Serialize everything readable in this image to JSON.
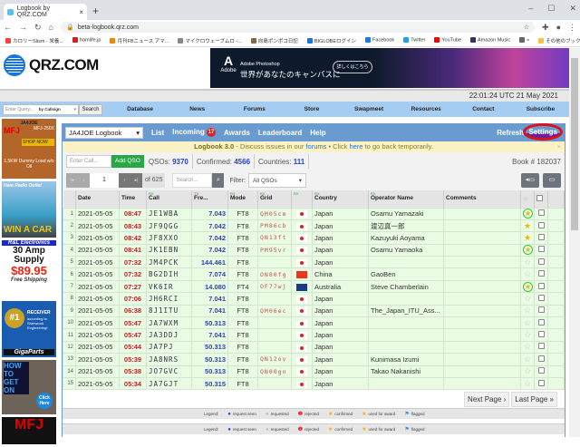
{
  "browser": {
    "tab_title": "Logbook by QRZ.COM",
    "url": "beta-logbook.qrz.com",
    "bookmarks": [
      "カロリーSlism - 栄養...",
      "hamlife.jp",
      "月刊FBニュース アマ...",
      "マイクロウェーブムロ -...",
      "向島ポンポコ日記",
      "BIGLOBEログイン",
      "Facebook",
      "Twitter",
      "YouTube",
      "Amazon Music",
      "»",
      "その他のブックマーク"
    ]
  },
  "site": {
    "logo": "QRZ.COM",
    "timestamp": "22:01:24 UTC 21 May 2021",
    "ad": {
      "brand": "Adobe",
      "product": "Adobe Photoshop",
      "headline": "世界があなたのキャンバスに",
      "cta": "詳しくはこちら"
    },
    "query_placeholder": "Enter Query...",
    "query_mode": "by Callsign",
    "search_label": "Search",
    "nav": [
      "Database",
      "News",
      "Forums",
      "Store",
      "Swapmeet",
      "Resources",
      "Contact",
      "Subscribe"
    ]
  },
  "side_ads": [
    {
      "title": "JA4JOE",
      "brand": "MFJ",
      "model": "MFJ-250X",
      "cta": "SHOP NOW",
      "desc": "1.5KW Dummy Load w/o Oil"
    },
    {
      "title": "Ham Radio Outlet",
      "cta": "WIN A CAR"
    },
    {
      "brand": "R&L Electronics",
      "line1": "30 Amp",
      "line2": "Supply",
      "price": "$89.95",
      "note": "Free Shipping"
    },
    {
      "rank": "#1",
      "title": "RECEIVER",
      "desc": "according to Sherwood Engineering!",
      "brand": "GigaParts"
    },
    {
      "title": "HOW TO GET ON",
      "cta": "Click Here"
    },
    {
      "brand": "MFJ"
    }
  ],
  "logbook": {
    "selected": "JA4JOE Logbook",
    "menu": {
      "list": "List",
      "incoming": "Incoming",
      "incoming_count": "17",
      "awards": "Awards",
      "leaderboard": "Leaderboard",
      "help": "Help",
      "refresh": "Refresh",
      "settings": "Settings"
    },
    "banner": {
      "title": "Logbook 3.0",
      "t1": " - Discuss issues in our ",
      "link1": "forums",
      "t2": " • Click ",
      "link2": "here",
      "t3": " to go back temporarily.",
      "close": "×"
    },
    "call_placeholder": "Enter Call...",
    "add_qso": "Add QSO",
    "stats": {
      "qsos_label": "QSOs:",
      "qsos": "9370",
      "confirmed_label": "Confirmed:",
      "confirmed": "4566",
      "countries_label": "Countries:",
      "countries": "111",
      "book": "Book # 182037"
    },
    "pager": {
      "page": "1",
      "of": "of 625",
      "search_placeholder": "Search...",
      "filter_label": "Filter:",
      "filter": "All QSOs"
    },
    "columns": [
      "Date",
      "Time",
      "Call",
      "Fre...",
      "Mode",
      "Grid",
      "Country",
      "Operator Name",
      "Comments"
    ],
    "rows": [
      [
        "1",
        "2021-05-05",
        "08:47",
        "JE1WBA",
        "7.043",
        "FT8",
        "QM05cm",
        "jp",
        "Japan",
        "Osamu Yamazaki",
        "award"
      ],
      [
        "2",
        "2021-05-05",
        "08:43",
        "JF9QGG",
        "7.042",
        "FT8",
        "PM86cb",
        "jp",
        "Japan",
        "渡辺真一郎",
        "conf"
      ],
      [
        "3",
        "2021-05-05",
        "08:42",
        "JF8XXO",
        "7.042",
        "FT8",
        "QN13ft",
        "jp",
        "Japan",
        "Kazuyuki Aoyama",
        "conf"
      ],
      [
        "4",
        "2021-05-05",
        "08:41",
        "JK1EBN",
        "7.042",
        "FT8",
        "PM95vr",
        "jp",
        "Japan",
        "Osamu Yamaoka",
        "award"
      ],
      [
        "5",
        "2021-05-05",
        "07:32",
        "JM4PCK",
        "144.461",
        "FT8",
        "",
        "jp",
        "Japan",
        "",
        "none"
      ],
      [
        "6",
        "2021-05-05",
        "07:32",
        "BG2DIH",
        "7.074",
        "FT8",
        "ON80fg",
        "cn",
        "China",
        "GaoBen",
        "none"
      ],
      [
        "7",
        "2021-05-05",
        "07:27",
        "VK6IR",
        "14.080",
        "FT4",
        "OF77wj",
        "au",
        "Australia",
        "Steve Chamberlain",
        "award"
      ],
      [
        "8",
        "2021-05-05",
        "07:06",
        "JH6RCI",
        "7.041",
        "FT8",
        "",
        "jp",
        "Japan",
        "",
        "none"
      ],
      [
        "9",
        "2021-05-05",
        "06:38",
        "8J1ITU",
        "7.041",
        "FT8",
        "QM06ec",
        "jp",
        "Japan",
        "The_Japan_ITU_Ass...",
        "none"
      ],
      [
        "10",
        "2021-05-05",
        "05:47",
        "JA7WXM",
        "50.313",
        "FT8",
        "",
        "jp",
        "Japan",
        "",
        "none"
      ],
      [
        "11",
        "2021-05-05",
        "05:47",
        "JA3DDJ",
        "7.041",
        "FT8",
        "",
        "jp",
        "Japan",
        "",
        "none"
      ],
      [
        "12",
        "2021-05-05",
        "05:44",
        "JA7PJ",
        "50.313",
        "FT8",
        "",
        "jp",
        "Japan",
        "",
        "none"
      ],
      [
        "13",
        "2021-05-05",
        "05:39",
        "JA8NRS",
        "50.313",
        "FT8",
        "QN12ov",
        "jp",
        "Japan",
        "Kunimasa Izumi",
        "none"
      ],
      [
        "14",
        "2021-05-05",
        "05:38",
        "JO7GVC",
        "50.313",
        "FT8",
        "QN00gn",
        "jp",
        "Japan",
        "Takao Nakanishi",
        "none"
      ],
      [
        "15",
        "2021-05-05",
        "05:34",
        "JA7GJT",
        "50.315",
        "FT8",
        "",
        "jp",
        "Japan",
        "",
        "none"
      ]
    ],
    "next_page": "Next Page ›",
    "last_page": "Last Page »",
    "legend": {
      "label": "Legend:",
      "items": [
        "request seen",
        "requested",
        "rejected",
        "confirmed",
        "used for award",
        "flagged"
      ]
    }
  }
}
